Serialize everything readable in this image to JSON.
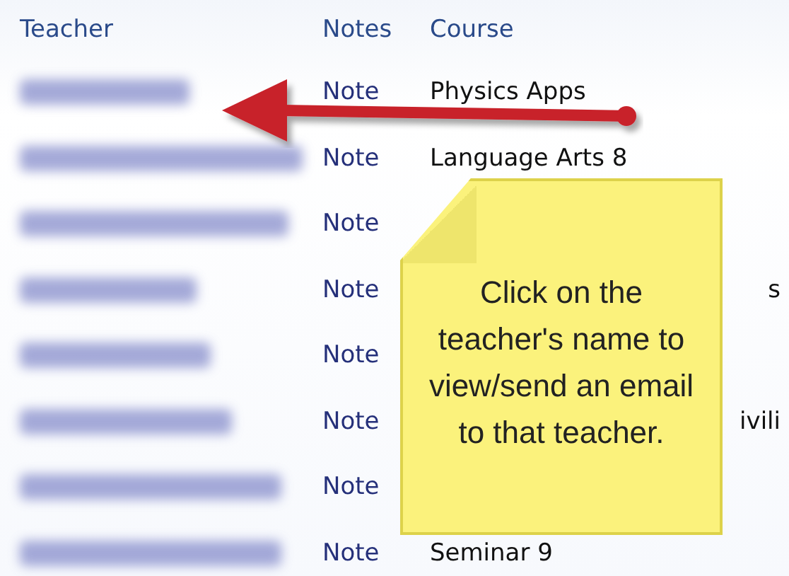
{
  "table": {
    "columns": [
      "Teacher",
      "Notes",
      "Course"
    ],
    "rows": [
      {
        "teacher_blurred": true,
        "note": "Note",
        "course": "Physics Apps",
        "course_cut": false
      },
      {
        "teacher_blurred": true,
        "note": "Note",
        "course": "Language Arts 8",
        "course_cut": false
      },
      {
        "teacher_blurred": true,
        "note": "Note"
      },
      {
        "teacher_blurred": true,
        "note": "Note",
        "course": "s",
        "course_cut": true
      },
      {
        "teacher_blurred": true,
        "note": "Note"
      },
      {
        "teacher_blurred": true,
        "note": "Note",
        "course": "ivili",
        "course_cut": true
      },
      {
        "teacher_blurred": true,
        "note": "Note"
      },
      {
        "teacher_blurred": true,
        "note": "Note",
        "course": "Seminar 9",
        "course_cut": false
      }
    ]
  },
  "callout": {
    "text": "Click on the teacher's name to view/send an email to that teacher."
  }
}
